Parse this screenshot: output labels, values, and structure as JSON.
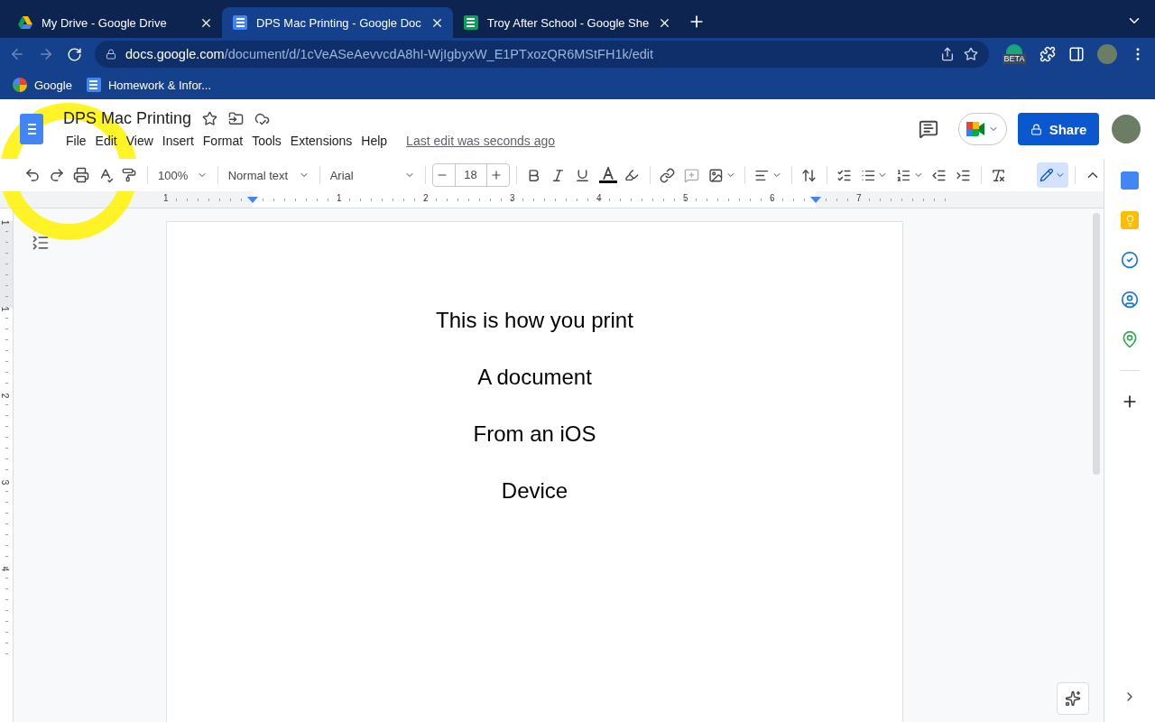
{
  "browser": {
    "tabs": [
      {
        "kind": "drive",
        "label": "My Drive - Google Drive",
        "selected": false
      },
      {
        "kind": "docs",
        "label": "DPS Mac Printing - Google Doc",
        "selected": true
      },
      {
        "kind": "sheets",
        "label": "Troy After School - Google She",
        "selected": false
      }
    ],
    "address": {
      "host": "docs.google.com",
      "path": "/document/d/1cVeASeAevvcdA8hI-WjIgbyxW_E1PTxozQR6MStFH1k/edit"
    },
    "extension_badge": "BETA",
    "bookmarks": [
      {
        "kind": "google",
        "label": "Google"
      },
      {
        "kind": "docs",
        "label": "Homework & Infor..."
      }
    ]
  },
  "document": {
    "title": "DPS Mac Printing",
    "menus": [
      "File",
      "Edit",
      "View",
      "Insert",
      "Format",
      "Tools",
      "Extensions",
      "Help"
    ],
    "last_edit": "Last edit was seconds ago",
    "share_label": "Share",
    "toolbar": {
      "zoom": "100%",
      "style": "Normal text",
      "font": "Arial",
      "font_size": "18"
    },
    "ruler": {
      "horizontal": [
        "1",
        "1",
        "2",
        "3",
        "4",
        "5",
        "6",
        "7"
      ],
      "vertical": [
        "1",
        "1",
        "2",
        "3",
        "4"
      ]
    },
    "paragraphs": [
      "This is how you print",
      "A document",
      "From an iOS",
      "Device"
    ]
  }
}
